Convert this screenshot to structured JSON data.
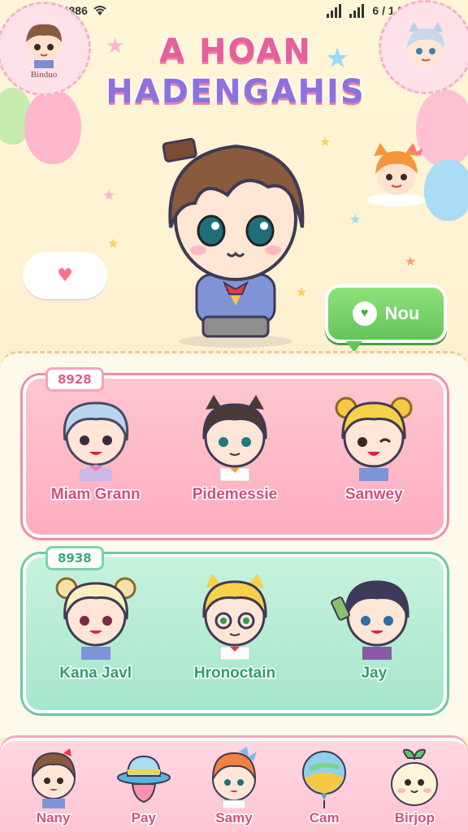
{
  "status_bar": {
    "time": "321 23 4886",
    "right_text": "6 / 1 %"
  },
  "header": {
    "title_line1": "A HOAN",
    "title_line2": "HADENGAHIS",
    "left_avatar_name": "Binduo"
  },
  "now_button": {
    "label": "Nou"
  },
  "groups": [
    {
      "tag": "8928",
      "members": [
        {
          "name": "Miam Grann"
        },
        {
          "name": "Pidemessie"
        },
        {
          "name": "Sanwey"
        }
      ]
    },
    {
      "tag": "8938",
      "members": [
        {
          "name": "Kana Javl"
        },
        {
          "name": "Hronoctain"
        },
        {
          "name": "Jay"
        }
      ]
    }
  ],
  "bottom_nav": [
    {
      "label": "Nany",
      "icon": "boy-avatar-icon"
    },
    {
      "label": "Pay",
      "icon": "hat-icon"
    },
    {
      "label": "Samy",
      "icon": "girl-avatar-icon"
    },
    {
      "label": "Cam",
      "icon": "balloon-icon"
    },
    {
      "label": "Birjop",
      "icon": "sprout-creature-icon"
    }
  ],
  "colors": {
    "accent_pink": "#e85f9a",
    "accent_purple": "#8c72e0",
    "accent_green": "#63c55a",
    "panel_pink": "#ffadc0",
    "panel_mint": "#a6e6cc"
  }
}
